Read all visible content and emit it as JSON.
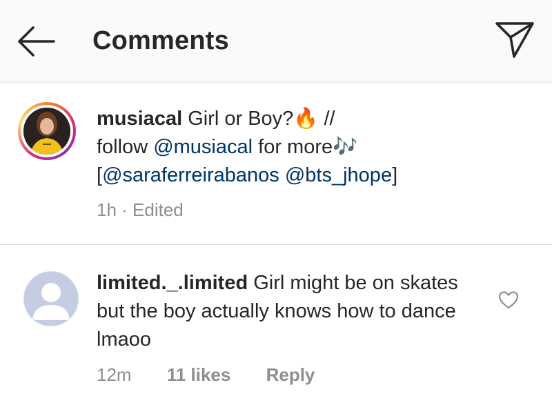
{
  "header": {
    "title": "Comments",
    "back_icon": "arrow-left-icon",
    "send_icon": "paper-plane-icon"
  },
  "caption": {
    "username": "musiacal",
    "text_part1": " Girl or Boy?",
    "fire_emoji": "🔥",
    "text_part2": " //",
    "line2_prefix": "follow ",
    "mention_main": "@musiacal",
    "line2_suffix": " for more",
    "music_emoji": "🎶",
    "bracket_open": "[",
    "mention_1": "@saraferreirabanos",
    "space": " ",
    "mention_2": "@bts_jhope",
    "bracket_close": "]",
    "time": "1h",
    "separator": " · ",
    "edited": "Edited"
  },
  "comment": {
    "username": "limited._.limited",
    "text": " Girl might be on skates but the boy actually knows how to dance lmaoo",
    "time": "12m",
    "likes": "11 likes",
    "reply": "Reply",
    "like_icon": "heart-outline-icon"
  },
  "colors": {
    "mention": "#003569",
    "muted": "#8e8e8e",
    "text": "#262626"
  }
}
